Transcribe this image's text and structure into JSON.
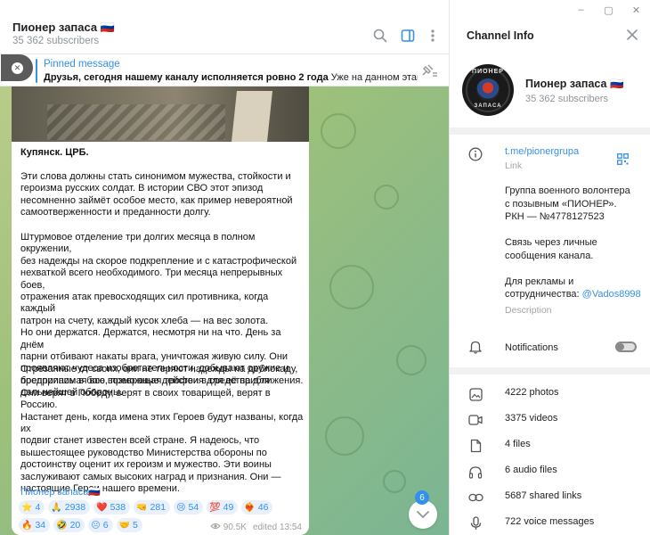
{
  "window": {
    "controls": [
      "–",
      "▢",
      "✕"
    ]
  },
  "chat_header": {
    "title": "Пионер запаса 🇷🇺",
    "subscribers": "35 362 subscribers"
  },
  "pinned": {
    "label": "Pinned message",
    "text_bold": "Друзья, сегодня нашему каналу исполняется ровно 2 года",
    "text_rest": "  Уже на данном этапе ..."
  },
  "message": {
    "title": "Купянск. ЦРБ.",
    "paragraphs": [
      "Эти слова должны стать синонимом мужества, стойкости и\nгероизма русских солдат. В истории СВО этот эпизод\nнесомненно займёт особое место, как пример невероятной\nсамоотверженности и преданности долгу.",
      "Штурмовое отделение три долгих месяца в полном окружении,\nбез надежды на скорое подкрепление и с катастрофической\nнехваткой всего необходимого. Три месяца непрерывных боев,\nотражения атак превосходящих сил противника, когда каждый\nпатрон на счету, каждый кусок хлеба — на вес золота.\nНо они держатся. Держатся, несмотря ни на что. День за днём\nпарни отбивают накаты врага, уничтожая живую силу. Они\nпроявляют чудеса изобретательности, добывают оружие и\nбоеприпасы в бою, превращая трофеи в средства для\nдальнейшей обороны.",
      "Отрезанные от своих, они не теряют надежды на деблокаду,\nпредпринимая все возможные действия для её приближения.\nОни верят в Победу, верят в своих товарищей, верят в Россию.\nНастанет день, когда имена этих Героев будут названы, когда их\nподвиг станет известен всей стране. Я надеюсь, что\nвышестоящее руководство Министерства обороны по\nдостоинству оценит их героизм и мужество. Эти воины\nзаслуживают самых высоких наград и признания. Они —\nнастоящие Герои нашего времени."
    ],
    "signature": "Пионер запаса🇷🇺",
    "reactions": [
      {
        "emoji": "⭐",
        "count": "4"
      },
      {
        "emoji": "🙏",
        "count": "2938"
      },
      {
        "emoji": "❤️",
        "count": "538"
      },
      {
        "emoji": "🤜",
        "count": "281"
      },
      {
        "emoji": "😢",
        "count": "54"
      },
      {
        "emoji": "💯",
        "count": "49"
      },
      {
        "emoji": "❤️‍🔥",
        "count": "46"
      },
      {
        "emoji": "🔥",
        "count": "34"
      },
      {
        "emoji": "🤣",
        "count": "20"
      },
      {
        "emoji": "😐",
        "count": "6"
      },
      {
        "emoji": "🤝",
        "count": "5"
      }
    ],
    "views": "90.5K",
    "edited": "edited 13:54"
  },
  "scroll": {
    "unread_count": "6"
  },
  "info_panel": {
    "title": "Channel Info",
    "channel_name": "Пионер запаса 🇷🇺",
    "subscribers": "35 362 subscribers",
    "avatar_text_top": "ПИОНЕР",
    "avatar_text_bottom": "ЗАПАСА",
    "link": "t.me/pionergrupa",
    "link_label": "Link",
    "description_lines": [
      "Группа военного волонтера",
      "с позывным «ПИОНЕР».",
      "РКН — №4778127523",
      "",
      "Связь через личные",
      "сообщения канала.",
      "",
      "Для рекламы и",
      "сотрудничества: "
    ],
    "description_mention": "@Vados8998",
    "description_label": "Description",
    "notifications_label": "Notifications",
    "notifications_on": false,
    "media": [
      {
        "icon": "photo-icon",
        "label": "4222 photos"
      },
      {
        "icon": "video-icon",
        "label": "3375 videos"
      },
      {
        "icon": "file-icon",
        "label": "4 files"
      },
      {
        "icon": "headphones-icon",
        "label": "6 audio files"
      },
      {
        "icon": "link-icon",
        "label": "5687 shared links"
      },
      {
        "icon": "microphone-icon",
        "label": "722 voice messages"
      }
    ]
  },
  "colors": {
    "accent": "#3390ec",
    "muted": "#8e959b",
    "wallpaper_start": "#b9cc8a",
    "wallpaper_end": "#7bb594"
  }
}
